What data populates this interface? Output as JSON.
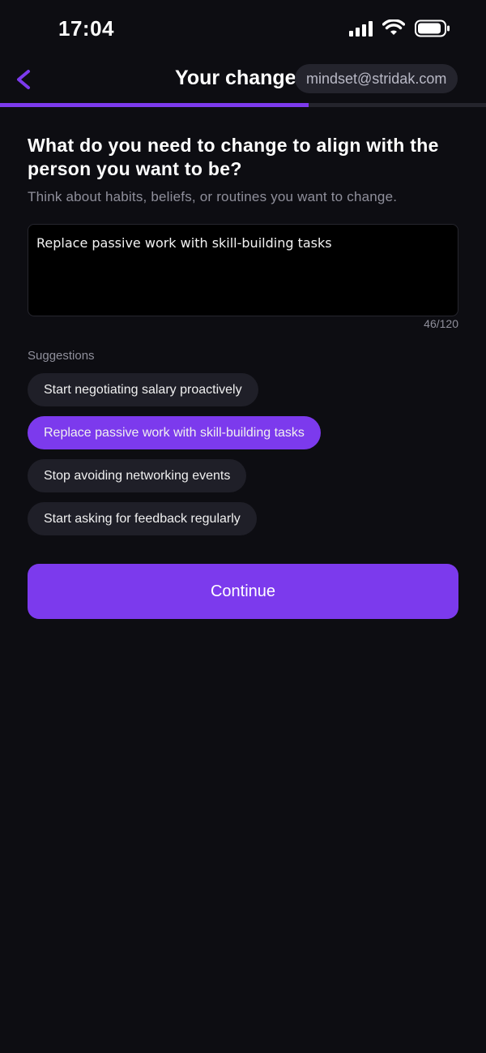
{
  "status_bar": {
    "time": "17:04",
    "icons": [
      "signal-icon",
      "wifi-icon",
      "battery-icon"
    ]
  },
  "nav": {
    "back_icon": "chevron-left-icon",
    "title": "Your change",
    "account_email": "mindset@stridak.com"
  },
  "progress": {
    "fraction": 0.635
  },
  "prompt": {
    "question": "What do you need to change to align with the person you want to be?",
    "hint": "Think about habits, beliefs, or routines you want to change."
  },
  "answer": {
    "value": "Replace passive work with skill-building tasks",
    "counter": "46/120"
  },
  "suggestions": {
    "label": "Suggestions",
    "items": [
      {
        "text": "Start negotiating salary proactively",
        "selected": false
      },
      {
        "text": "Replace passive work with skill-building tasks",
        "selected": true
      },
      {
        "text": "Stop avoiding networking events",
        "selected": false
      },
      {
        "text": "Start asking for feedback regularly",
        "selected": false
      }
    ]
  },
  "actions": {
    "continue_label": "Continue"
  },
  "colors": {
    "background": "#0d0d12",
    "accent": "#7c3aed",
    "chip": "#1f1f28",
    "muted_text": "#8f8f9b"
  }
}
